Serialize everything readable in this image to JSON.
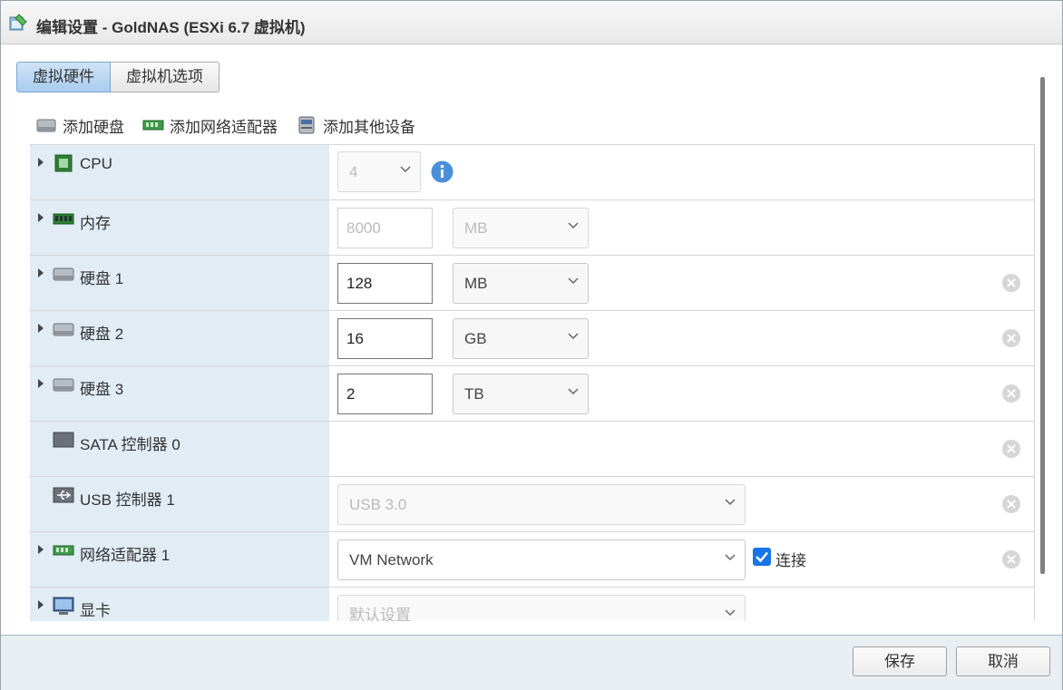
{
  "window": {
    "title": "编辑设置 - GoldNAS (ESXi 6.7 虚拟机)"
  },
  "tabs": [
    {
      "label": "虚拟硬件",
      "active": true
    },
    {
      "label": "虚拟机选项",
      "active": false
    }
  ],
  "toolbar": {
    "add_disk": "添加硬盘",
    "add_network": "添加网络适配器",
    "add_other": "添加其他设备"
  },
  "devices": [
    {
      "label": "CPU",
      "value": "4",
      "icon": "cpu-icon"
    },
    {
      "label": "内存",
      "value": "8000",
      "unit": "MB",
      "icon": "memory-icon"
    },
    {
      "label": "硬盘 1",
      "value": "128",
      "unit": "MB",
      "icon": "harddisk-icon"
    },
    {
      "label": "硬盘 2",
      "value": "16",
      "unit": "GB",
      "icon": "harddisk-icon"
    },
    {
      "label": "硬盘 3",
      "value": "2",
      "unit": "TB",
      "icon": "harddisk-icon"
    },
    {
      "label": "SATA 控制器 0",
      "icon": "sata-icon"
    },
    {
      "label": "USB 控制器 1",
      "value": "USB 3.0",
      "icon": "usb-icon"
    },
    {
      "label": "网络适配器 1",
      "value": "VM Network",
      "connect_label": "连接",
      "connected": true,
      "icon": "network-adapter-icon"
    },
    {
      "label": "显卡",
      "value": "默认设置",
      "icon": "display-icon"
    }
  ],
  "footer": {
    "save": "保存",
    "cancel": "取消"
  },
  "colors": {
    "accent": "#1a73e8",
    "label_bg": "#e1ecf5",
    "tab_active": "#a9ccef"
  }
}
